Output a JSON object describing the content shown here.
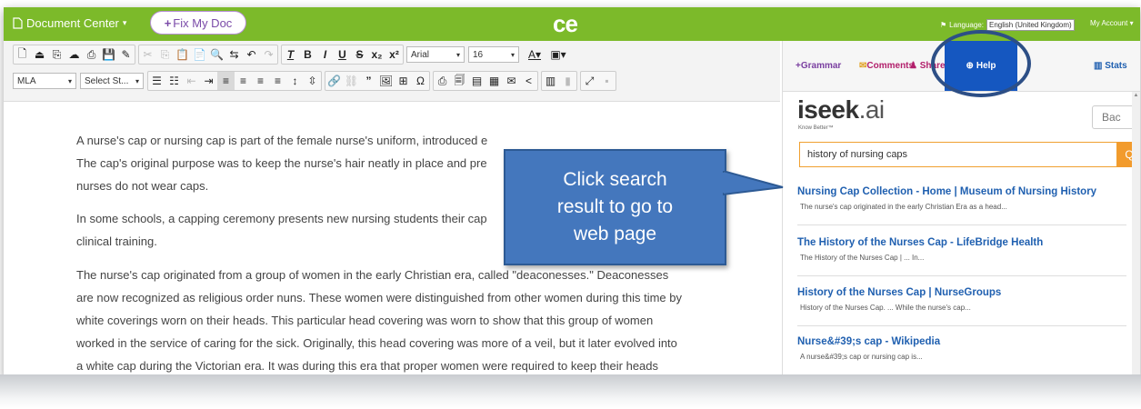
{
  "topbar": {
    "doc_center": "Document Center",
    "fix_doc": "Fix My Doc",
    "logo": "ce",
    "language_label": "Language:",
    "language_value": "English (United Kingdom)",
    "account": "My Account",
    "colors": {
      "bar": "#7cba2a",
      "fix_text": "#7a4aa8"
    }
  },
  "toolbar": {
    "font": "Arial",
    "size": "16",
    "style_select": "MLA",
    "select_style": "Select St..."
  },
  "document": {
    "paragraphs": [
      "A nurse's cap or nursing cap is part of the female nurse's uniform, introduced e",
      "The cap's original purpose was to keep the nurse's hair neatly in place and pre",
      "nurses do not wear caps.",
      "In some schools, a capping ceremony presents new nursing students their cap",
      "clinical training.",
      "The nurse's cap originated from a group of women in the early Christian era, called \"deaconesses.\" Deaconesses",
      "are now recognized as religious order nuns. These women were distinguished from other women during this time by",
      "white coverings worn on their heads. This particular head covering was worn to show that this group of women",
      "worked in the service of caring for the sick. Originally, this head covering was more of a veil, but it later evolved into",
      "a white cap during the Victorian era. It was during this era that proper women were required to keep their heads"
    ]
  },
  "panel": {
    "tabs": {
      "grammar": "Grammar",
      "comments": "Comments",
      "share": "Share",
      "help": "Help",
      "stats": "Stats"
    },
    "brand": {
      "name": "iseek",
      "suffix": ".ai",
      "tagline": "Know Better™"
    },
    "back_button": "Bac",
    "search_value": "history of nursing caps",
    "results": [
      {
        "title": "Nursing Cap Collection - Home | Museum of Nursing History",
        "snippet": "The nurse's cap originated in the early Christian Era as a head..."
      },
      {
        "title": "The History of the Nurses Cap - LifeBridge Health",
        "snippet": "The History of the Nurses Cap | ... In..."
      },
      {
        "title": "History of the Nurses Cap | NurseGroups",
        "snippet": "History of the Nurses Cap. ... While the nurse's cap..."
      },
      {
        "title": "Nurse&#39;s cap - Wikipedia",
        "snippet": "A nurse&#39;s cap or nursing cap is..."
      }
    ],
    "colors": {
      "help_tab": "#1557c0",
      "result_title": "#2060b0",
      "search_button": "#f29b2c"
    }
  },
  "callout": {
    "text": "Click search\nresult to go to\nweb page",
    "color": "#4477bd"
  }
}
